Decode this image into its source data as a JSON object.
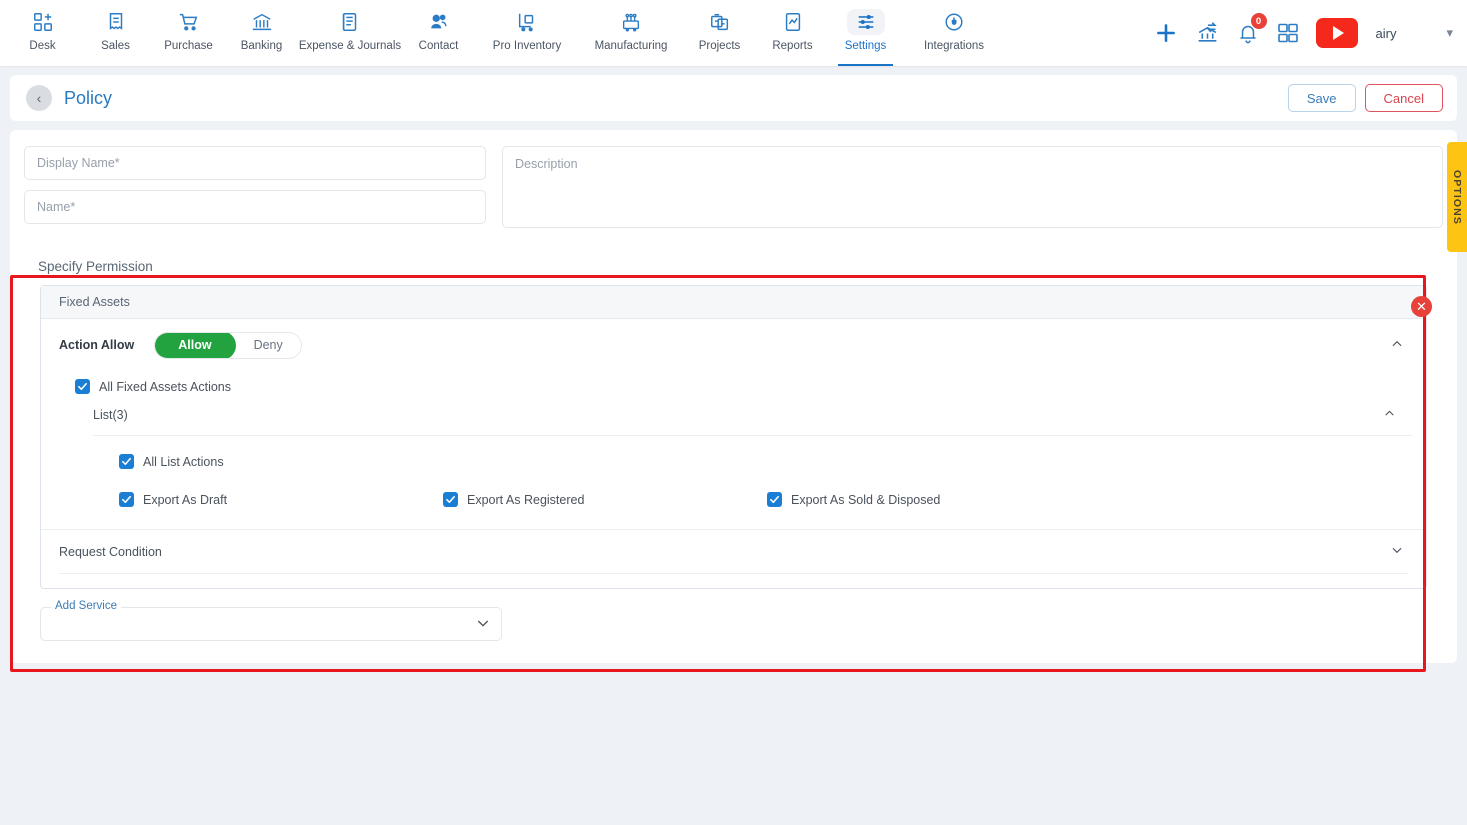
{
  "nav": {
    "items": [
      {
        "label": "Desk",
        "icon": "desk-icon",
        "active": false
      },
      {
        "label": "Sales",
        "icon": "sales-icon",
        "active": false
      },
      {
        "label": "Purchase",
        "icon": "purchase-cart-icon",
        "active": false
      },
      {
        "label": "Banking",
        "icon": "bank-icon",
        "active": false
      },
      {
        "label": "Expense & Journals",
        "icon": "journal-icon",
        "active": false
      },
      {
        "label": "Contact",
        "icon": "contact-people-icon",
        "active": false
      },
      {
        "label": "Pro Inventory",
        "icon": "inventory-cart-icon",
        "active": false
      },
      {
        "label": "Manufacturing",
        "icon": "manufacturing-icon",
        "active": false
      },
      {
        "label": "Projects",
        "icon": "projects-icon",
        "active": false
      },
      {
        "label": "Reports",
        "icon": "reports-icon",
        "active": false
      },
      {
        "label": "Settings",
        "icon": "settings-sliders-icon",
        "active": true
      },
      {
        "label": "Integrations",
        "icon": "integrations-plug-icon",
        "active": false
      }
    ]
  },
  "header_actions": {
    "add_icon": "plus-icon",
    "bank_transfer_icon": "bank-transfer-icon",
    "notifications_icon": "bell-icon",
    "notifications_count": "0",
    "apps_icon": "grid-apps-icon",
    "youtube_icon": "youtube-play-icon",
    "org_name": "airy",
    "account_chevron_icon": "chevron-down-icon"
  },
  "titlebar": {
    "back_icon": "chevron-left-icon",
    "title": "Policy",
    "save_label": "Save",
    "cancel_label": "Cancel"
  },
  "form": {
    "display_name_placeholder": "Display Name",
    "display_name_value": "",
    "name_placeholder": "Name",
    "name_value": "",
    "description_placeholder": "Description",
    "description_value": "",
    "required_marker": "*"
  },
  "options_tab": {
    "label": "OPTIONS"
  },
  "permission": {
    "section_title": "Specify Permission",
    "panel_title": "Fixed Assets",
    "action_allow_label": "Action Allow",
    "toggle": {
      "allow_label": "Allow",
      "deny_label": "Deny",
      "selected": "Allow"
    },
    "collapse_icon": "chevron-up-icon",
    "all_actions": {
      "label": "All Fixed Assets Actions",
      "checked": true
    },
    "list_group": {
      "label": "List(3)",
      "collapse_icon": "chevron-up-icon",
      "all_list_actions": {
        "label": "All List Actions",
        "checked": true
      },
      "items": [
        {
          "label": "Export As Draft",
          "checked": true
        },
        {
          "label": "Export As Registered",
          "checked": true
        },
        {
          "label": "Export As Sold & Disposed",
          "checked": true
        }
      ]
    },
    "request_condition": {
      "label": "Request Condition",
      "expand_icon": "chevron-down-icon"
    },
    "close_icon": "close-x-icon"
  },
  "add_service": {
    "label": "Add Service",
    "value": "",
    "chevron_icon": "chevron-down-icon"
  },
  "colors": {
    "accent_blue": "#1a73c7",
    "allow_green": "#22a33f",
    "highlight_red": "#e8171f",
    "cancel_red": "#d9434f",
    "checkbox_blue": "#1a7fd4",
    "options_yellow": "#fec413",
    "page_bg": "#eef2f6"
  }
}
